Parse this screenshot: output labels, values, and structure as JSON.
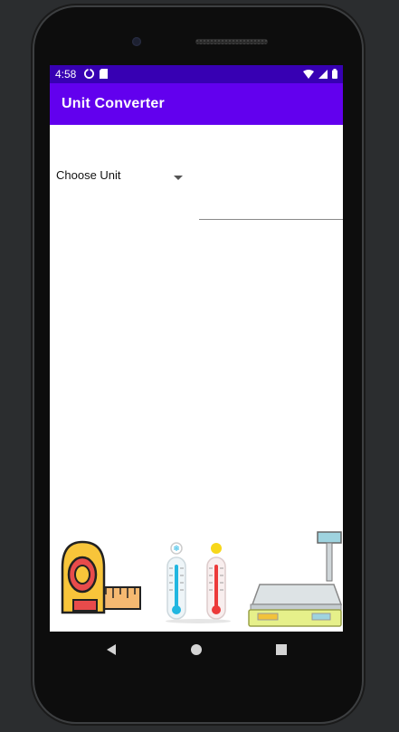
{
  "status_bar": {
    "time": "4:58",
    "left_icons": [
      "data-saver-icon",
      "sd-card-icon"
    ],
    "right_icons": [
      "wifi-icon",
      "signal-icon",
      "battery-icon"
    ]
  },
  "app_bar": {
    "title": "Unit Converter"
  },
  "converter": {
    "unit_spinner": {
      "selected": "Choose Unit"
    },
    "value_input": {
      "value": "",
      "placeholder": ""
    }
  },
  "illustrations": [
    "tape-measure-icon",
    "thermometer-cold-icon",
    "thermometer-hot-icon",
    "weighing-scale-icon"
  ],
  "nav_bar": [
    "back-icon",
    "home-icon",
    "recents-icon"
  ],
  "colors": {
    "status_bar": "#3700b3",
    "app_bar": "#6200ee",
    "background": "#ffffff"
  }
}
